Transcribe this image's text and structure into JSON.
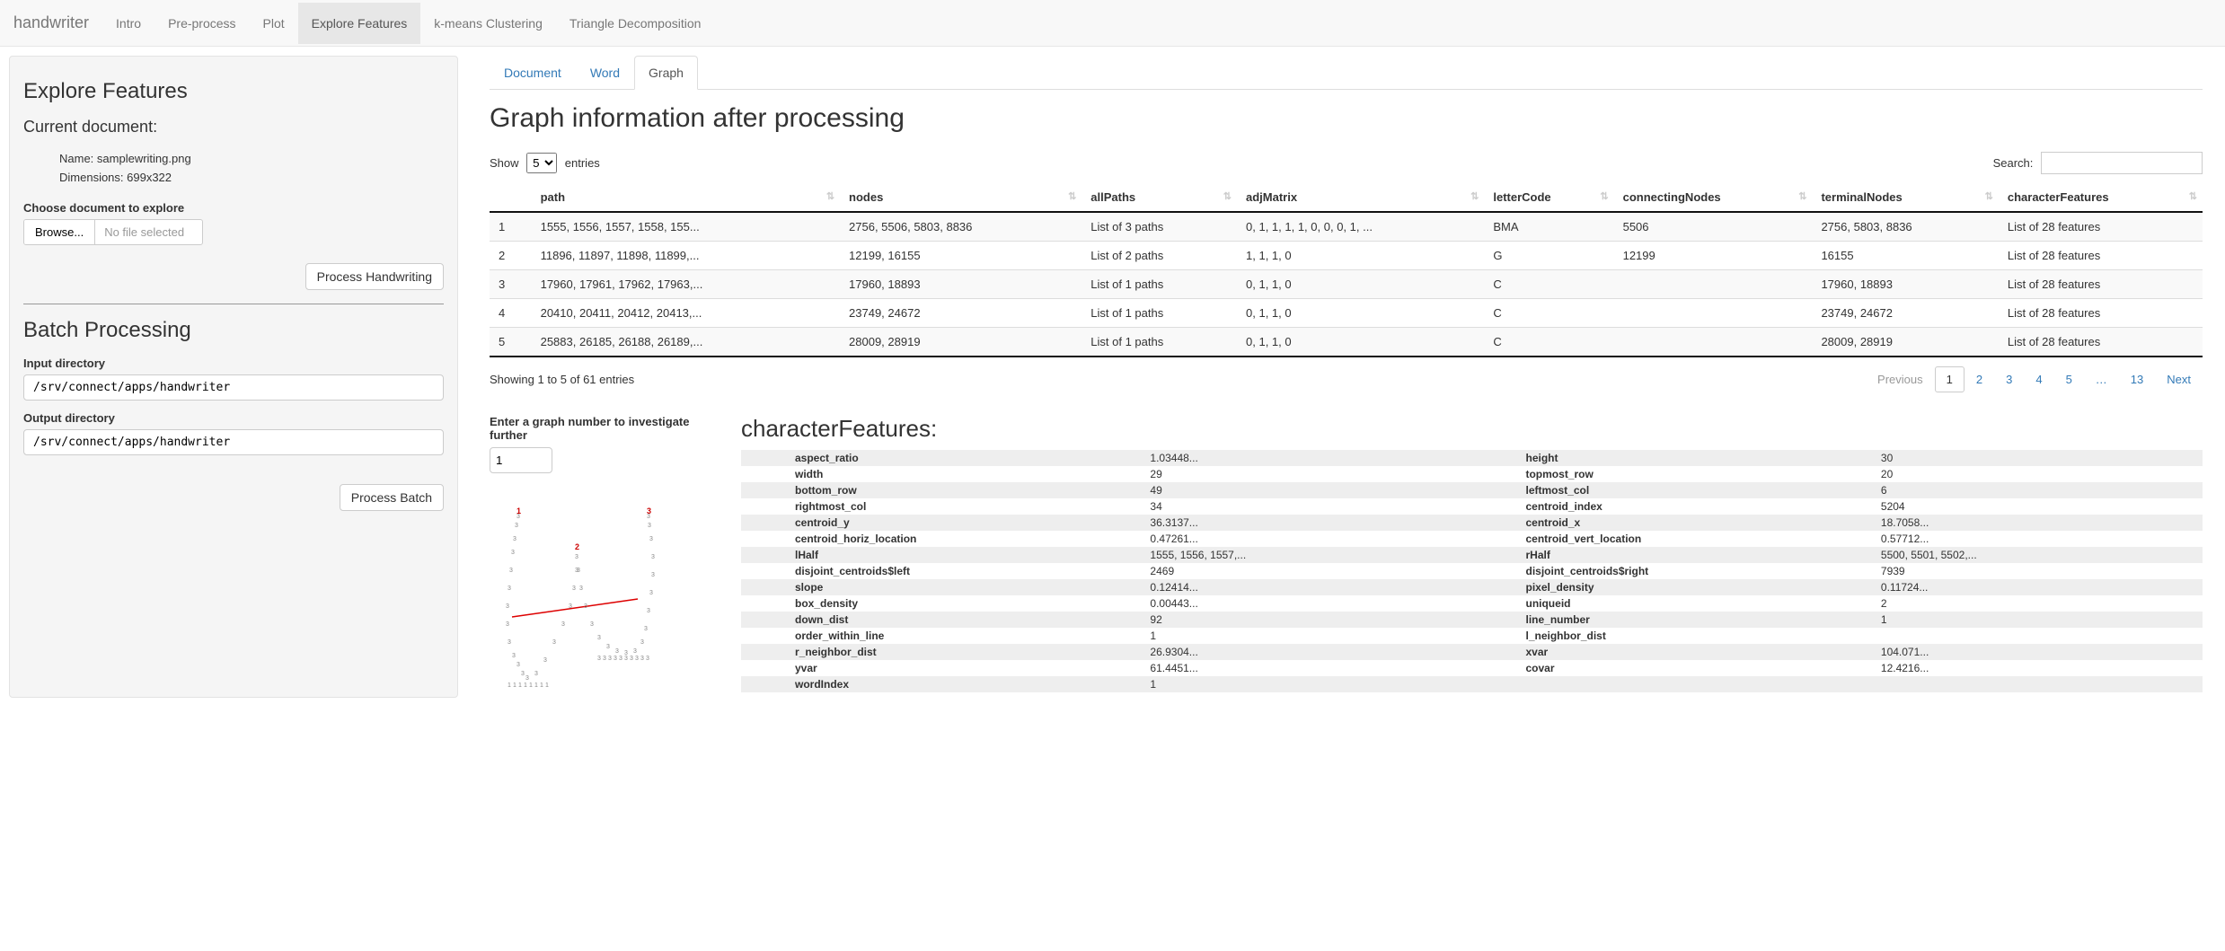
{
  "navbar": {
    "brand": "handwriter",
    "tabs": [
      "Intro",
      "Pre-process",
      "Plot",
      "Explore Features",
      "k-means Clustering",
      "Triangle Decomposition"
    ],
    "active_index": 3
  },
  "sidebar": {
    "title": "Explore Features",
    "current_doc_label": "Current document:",
    "doc_name_label": "Name: ",
    "doc_name": "samplewriting.png",
    "doc_dim_label": "Dimensions: ",
    "doc_dim": "699x322",
    "choose_label": "Choose document to explore",
    "browse_btn": "Browse...",
    "file_status": "No file selected",
    "process_btn": "Process Handwriting",
    "batch_title": "Batch Processing",
    "input_dir_label": "Input directory",
    "input_dir_value": "/srv/connect/apps/handwriter",
    "output_dir_label": "Output directory",
    "output_dir_value": "/srv/connect/apps/handwriter",
    "process_batch_btn": "Process Batch"
  },
  "subtabs": {
    "items": [
      "Document",
      "Word",
      "Graph"
    ],
    "active_index": 2
  },
  "main": {
    "heading": "Graph information after processing",
    "show_label": "Show",
    "entries_label": "entries",
    "page_size": "5",
    "search_label": "Search:",
    "columns": [
      "",
      "path",
      "nodes",
      "allPaths",
      "adjMatrix",
      "letterCode",
      "connectingNodes",
      "terminalNodes",
      "characterFeatures"
    ],
    "rows": [
      {
        "n": "1",
        "path": "1555, 1556, 1557, 1558, 155...",
        "nodes": "2756, 5506, 5803, 8836",
        "allPaths": "List of 3 paths",
        "adjMatrix": "0, 1, 1, 1, 1, 0, 0, 0, 1, ...",
        "letterCode": "BMA",
        "connectingNodes": "5506",
        "terminalNodes": "2756, 5803, 8836",
        "characterFeatures": "List of 28 features"
      },
      {
        "n": "2",
        "path": "11896, 11897, 11898, 11899,...",
        "nodes": "12199, 16155",
        "allPaths": "List of 2 paths",
        "adjMatrix": "1, 1, 1, 0",
        "letterCode": "G",
        "connectingNodes": "12199",
        "terminalNodes": "16155",
        "characterFeatures": "List of 28 features"
      },
      {
        "n": "3",
        "path": "17960, 17961, 17962, 17963,...",
        "nodes": "17960, 18893",
        "allPaths": "List of 1 paths",
        "adjMatrix": "0, 1, 1, 0",
        "letterCode": "C",
        "connectingNodes": "",
        "terminalNodes": "17960, 18893",
        "characterFeatures": "List of 28 features"
      },
      {
        "n": "4",
        "path": "20410, 20411, 20412, 20413,...",
        "nodes": "23749, 24672",
        "allPaths": "List of 1 paths",
        "adjMatrix": "0, 1, 1, 0",
        "letterCode": "C",
        "connectingNodes": "",
        "terminalNodes": "23749, 24672",
        "characterFeatures": "List of 28 features"
      },
      {
        "n": "5",
        "path": "25883, 26185, 26188, 26189,...",
        "nodes": "28009, 28919",
        "allPaths": "List of 1 paths",
        "adjMatrix": "0, 1, 1, 0",
        "letterCode": "C",
        "connectingNodes": "",
        "terminalNodes": "28009, 28919",
        "characterFeatures": "List of 28 features"
      }
    ],
    "info_text": "Showing 1 to 5 of 61 entries",
    "pagination": {
      "prev": "Previous",
      "pages": [
        "1",
        "2",
        "3",
        "4",
        "5",
        "…",
        "13"
      ],
      "next": "Next",
      "current_index": 0
    }
  },
  "graph_input": {
    "label": "Enter a graph number to investigate further",
    "value": "1"
  },
  "features": {
    "title": "characterFeatures:",
    "rows": [
      [
        "aspect_ratio",
        "1.03448...",
        "height",
        "30"
      ],
      [
        "width",
        "29",
        "topmost_row",
        "20"
      ],
      [
        "bottom_row",
        "49",
        "leftmost_col",
        "6"
      ],
      [
        "rightmost_col",
        "34",
        "centroid_index",
        "5204"
      ],
      [
        "centroid_y",
        "36.3137...",
        "centroid_x",
        "18.7058..."
      ],
      [
        "centroid_horiz_location",
        "0.47261...",
        "centroid_vert_location",
        "0.57712..."
      ],
      [
        "lHalf",
        "1555, 1556, 1557,...",
        "rHalf",
        "5500, 5501, 5502,..."
      ],
      [
        "disjoint_centroids$left",
        "2469",
        "disjoint_centroids$right",
        "7939"
      ],
      [
        "slope",
        "0.12414...",
        "pixel_density",
        "0.11724..."
      ],
      [
        "box_density",
        "0.00443...",
        "uniqueid",
        "2"
      ],
      [
        "down_dist",
        "92",
        "line_number",
        "1"
      ],
      [
        "order_within_line",
        "1",
        "l_neighbor_dist",
        ""
      ],
      [
        "r_neighbor_dist",
        "26.9304...",
        "xvar",
        "104.071..."
      ],
      [
        "yvar",
        "61.4451...",
        "covar",
        "12.4216..."
      ],
      [
        "wordIndex",
        "1",
        "",
        ""
      ]
    ]
  },
  "chart_data": {
    "type": "scatter",
    "title": "",
    "note": "Glyph skeleton plot with three labeled node clusters and a trend line",
    "marks": [
      {
        "label": "1",
        "x": 30,
        "y": 15
      },
      {
        "label": "2",
        "x": 95,
        "y": 55
      },
      {
        "label": "3",
        "x": 175,
        "y": 15
      }
    ],
    "line": {
      "x1": 25,
      "y1": 130,
      "x2": 165,
      "y2": 110
    },
    "glyph_points_label": "3",
    "xlim": [
      0,
      220
    ],
    "ylim": [
      0,
      220
    ]
  }
}
